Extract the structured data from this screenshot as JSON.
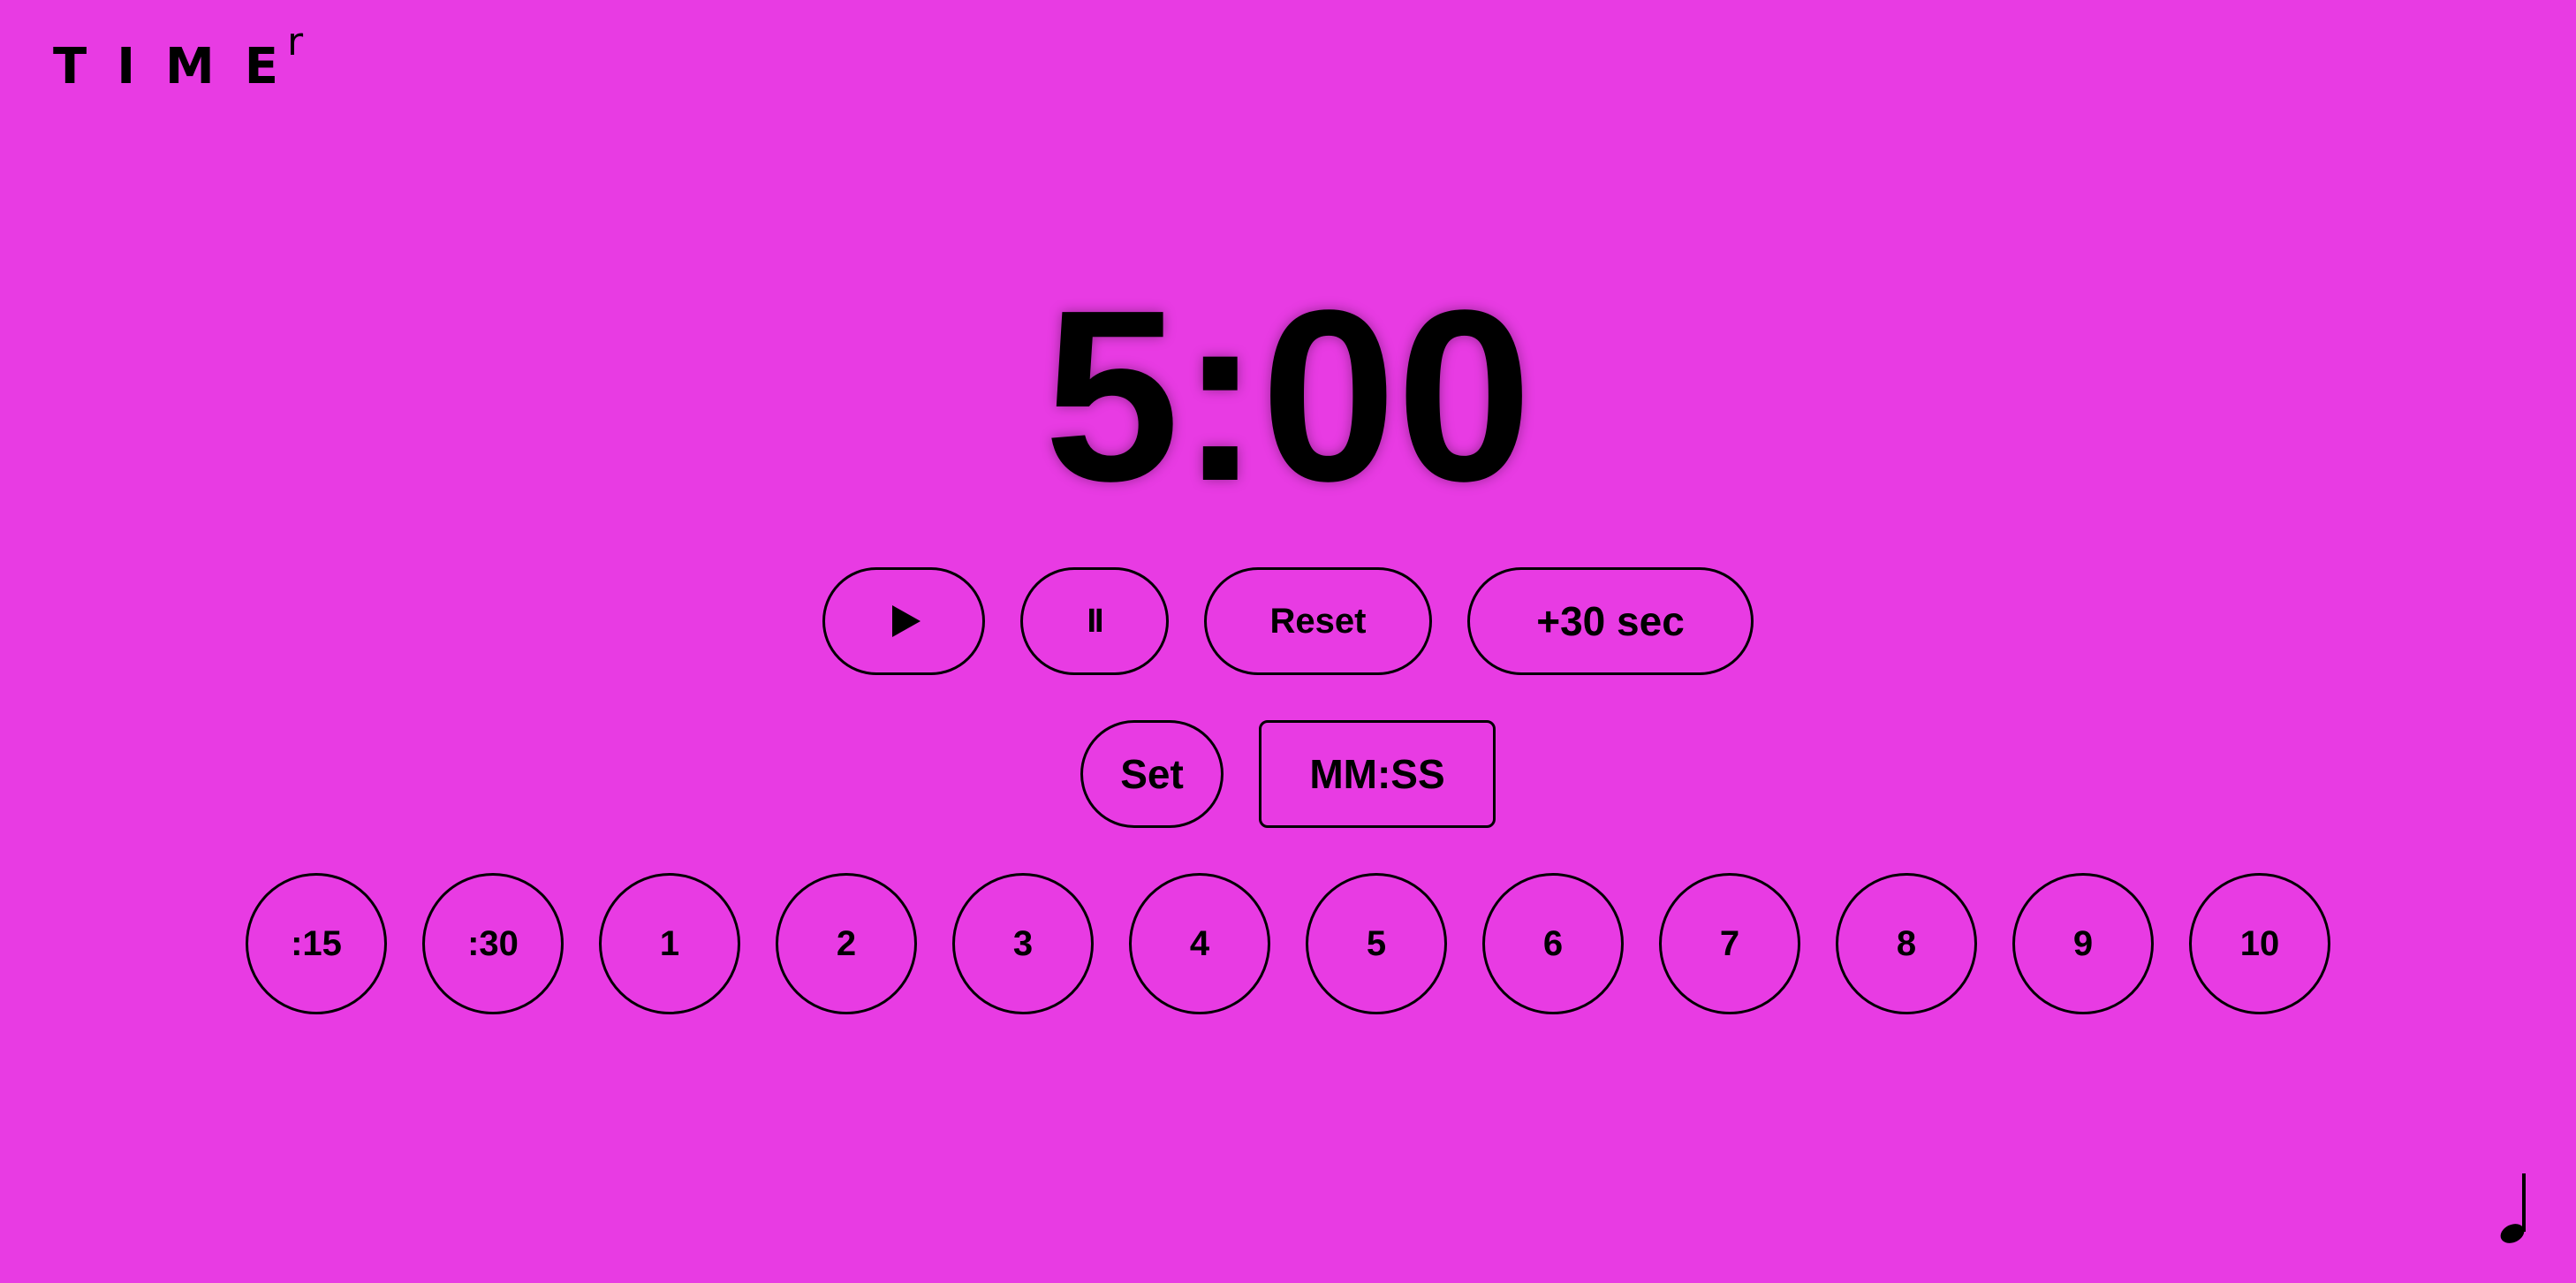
{
  "logo": {
    "main": "TIME",
    "sup": "r"
  },
  "timer": {
    "display": "5:00"
  },
  "controls": {
    "play_icon": "play-icon",
    "pause_label": "II",
    "reset_label": "Reset",
    "add_label": "+30 sec",
    "set_label": "Set",
    "time_input_placeholder": "MM:SS"
  },
  "presets": [
    ":15",
    ":30",
    "1",
    "2",
    "3",
    "4",
    "5",
    "6",
    "7",
    "8",
    "9",
    "10"
  ],
  "colors": {
    "background": "#e83be3",
    "foreground": "#000000"
  },
  "icons": {
    "sound": "music-note-icon"
  }
}
